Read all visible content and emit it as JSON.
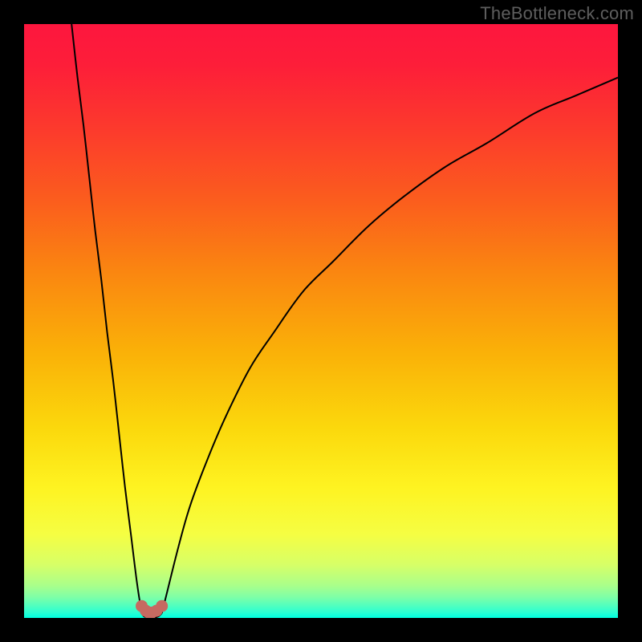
{
  "watermark": "TheBottleneck.com",
  "colors": {
    "frame": "#000000",
    "gradient_stops": [
      {
        "offset": 0.0,
        "color": "#fd163e"
      },
      {
        "offset": 0.07,
        "color": "#fd1e39"
      },
      {
        "offset": 0.18,
        "color": "#fc3b2c"
      },
      {
        "offset": 0.3,
        "color": "#fb5e1d"
      },
      {
        "offset": 0.42,
        "color": "#fa8710"
      },
      {
        "offset": 0.55,
        "color": "#fab008"
      },
      {
        "offset": 0.68,
        "color": "#fbd80c"
      },
      {
        "offset": 0.78,
        "color": "#fef321"
      },
      {
        "offset": 0.86,
        "color": "#f5fe43"
      },
      {
        "offset": 0.91,
        "color": "#d7ff67"
      },
      {
        "offset": 0.945,
        "color": "#aaff8a"
      },
      {
        "offset": 0.965,
        "color": "#7effa7"
      },
      {
        "offset": 0.98,
        "color": "#4fffc0"
      },
      {
        "offset": 0.99,
        "color": "#2dffd1"
      },
      {
        "offset": 1.0,
        "color": "#00ffe0"
      }
    ],
    "curve": "#000000",
    "marker_fill": "#c66a61",
    "marker_stroke": "#9a4e47"
  },
  "chart_data": {
    "type": "line",
    "title": "",
    "xlabel": "",
    "ylabel": "",
    "xlim": [
      0,
      100
    ],
    "ylim": [
      0,
      100
    ],
    "grid": false,
    "legend": false,
    "series": [
      {
        "name": "left-branch",
        "x": [
          8,
          9,
          10,
          11,
          12,
          13,
          14,
          15,
          16,
          17,
          18,
          19,
          19.8
        ],
        "y": [
          100,
          91,
          83,
          74,
          65,
          57,
          48,
          40,
          31,
          22,
          14,
          6,
          0.8
        ]
      },
      {
        "name": "right-branch",
        "x": [
          23.2,
          24,
          26,
          28,
          31,
          34,
          38,
          42,
          47,
          52,
          58,
          64,
          71,
          78,
          86,
          93,
          100
        ],
        "y": [
          0.8,
          4,
          12,
          19,
          27,
          34,
          42,
          48,
          55,
          60,
          66,
          71,
          76,
          80,
          85,
          88,
          91
        ]
      },
      {
        "name": "valley-floor",
        "x": [
          19.8,
          20.2,
          21.0,
          21.8,
          22.6,
          23.2
        ],
        "y": [
          0.8,
          0.25,
          0.05,
          0.05,
          0.25,
          0.8
        ]
      }
    ],
    "markers": {
      "name": "highlighted-points",
      "x": [
        19.8,
        20.5,
        21.0,
        21.5,
        22.3,
        23.2
      ],
      "y": [
        2.0,
        1.2,
        0.9,
        0.9,
        1.2,
        2.0
      ]
    },
    "notes": "x-axis and y-axis have no visible tick labels; y=0 is bottom of gradient area; y=100 is top; x=0 left edge, x=100 right edge; values are visual estimates from pixel positions."
  }
}
